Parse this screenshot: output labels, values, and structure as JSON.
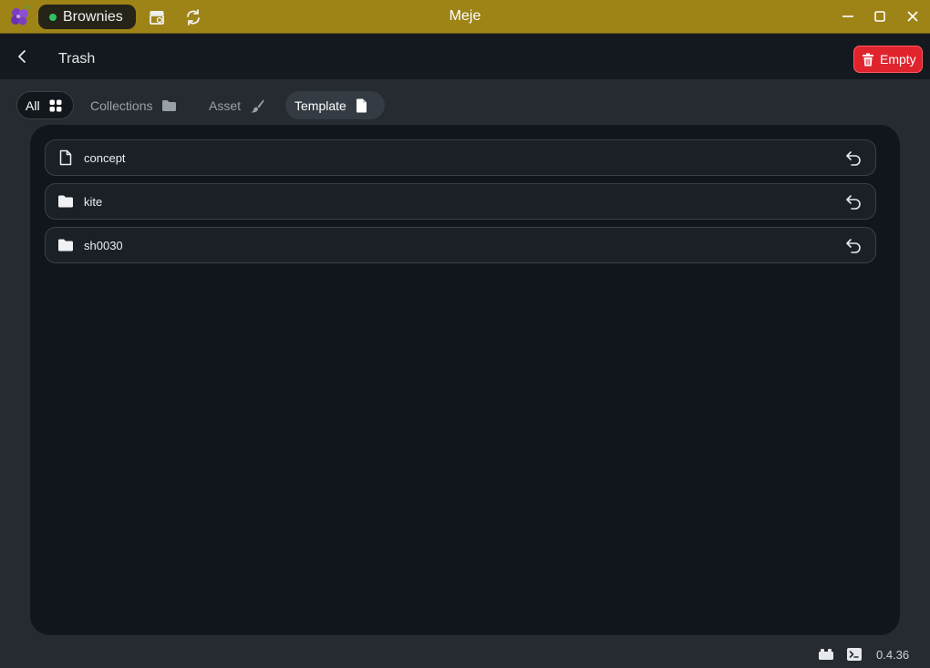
{
  "window": {
    "title": "Meje"
  },
  "project": {
    "name": "Brownies",
    "status_color": "#2ec45f"
  },
  "header": {
    "title": "Trash",
    "empty_label": "Empty"
  },
  "filters": [
    {
      "label": "All",
      "icon": "grid-icon",
      "active": true
    },
    {
      "label": "Collections",
      "icon": "folder-icon"
    },
    {
      "label": "Asset",
      "icon": "brush-icon"
    },
    {
      "label": "Template",
      "icon": "file-icon",
      "highlighted": true
    }
  ],
  "items": [
    {
      "name": "concept",
      "icon": "file-icon"
    },
    {
      "name": "kite",
      "icon": "folder-icon"
    },
    {
      "name": "sh0030",
      "icon": "folder-icon"
    }
  ],
  "status": {
    "version": "0.4.36"
  },
  "colors": {
    "titlebar": "#9e8417",
    "danger": "#e0242e",
    "panel": "#11161c"
  }
}
